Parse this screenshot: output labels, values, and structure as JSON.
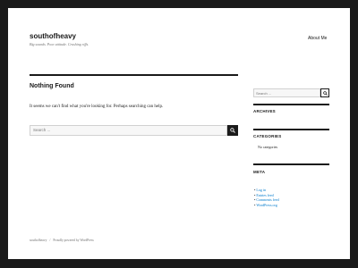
{
  "header": {
    "site_title": "southofheavy",
    "site_description": "Big sounds. Poor attitude. Crushing riffs.",
    "nav_about": "About Me"
  },
  "main": {
    "title": "Nothing Found",
    "message": "It seems we can't find what you're looking for. Perhaps searching can help.",
    "search_placeholder": "Search ..."
  },
  "sidebar": {
    "search_placeholder": "Search ...",
    "archives_title": "ARCHIVES",
    "categories_title": "CATEGORIES",
    "categories_empty": "No categories",
    "meta_title": "META",
    "meta_links": [
      "Log in",
      "Entries feed",
      "Comments feed",
      "WordPress.org"
    ]
  },
  "footer": {
    "site_name": "southofheavy",
    "separator": "/",
    "powered_by": "Proudly powered by WordPress"
  },
  "colors": {
    "background": "#1a1a1a",
    "page": "#ffffff",
    "link": "#007acc"
  }
}
